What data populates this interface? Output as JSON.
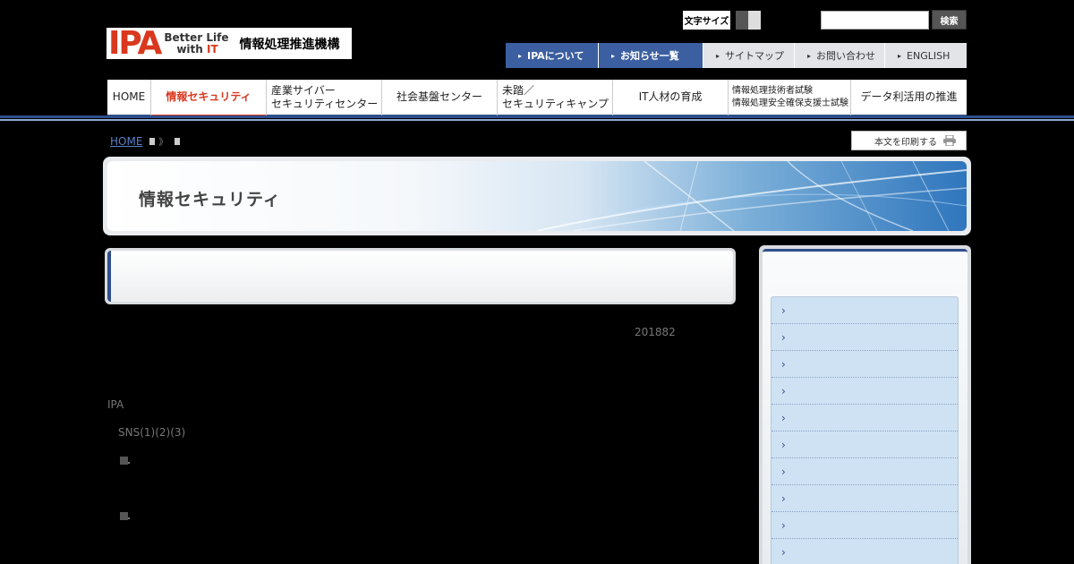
{
  "header": {
    "logo_mark": "IPA",
    "slogan_line1": "Better Life",
    "slogan_with": "with ",
    "slogan_it": "IT",
    "org_name": "情報処理推進機構",
    "font_size_label": "文字サイズ",
    "search_placeholder": "",
    "search_button": "検索"
  },
  "util_nav": [
    {
      "label": "IPAについて"
    },
    {
      "label": "お知らせ一覧"
    },
    {
      "label": "サイトマップ"
    },
    {
      "label": "お問い合わせ"
    },
    {
      "label": "ENGLISH"
    }
  ],
  "global_nav": [
    {
      "label": "HOME"
    },
    {
      "label": "情報セキュリティ"
    },
    {
      "line1": "産業サイバー",
      "line2": "セキュリティセンター"
    },
    {
      "label": "社会基盤センター"
    },
    {
      "line1": "未踏／",
      "line2": "セキュリティキャンプ"
    },
    {
      "label": "IT人材の育成"
    },
    {
      "line1": "情報処理技術者試験",
      "line2": "情報処理安全確保支援士試験"
    },
    {
      "label": "データ利活用の推進"
    }
  ],
  "breadcrumb": {
    "home": "HOME",
    "sep1": "》",
    "sep2": "》"
  },
  "print_button": "本文を印刷する",
  "banner_title": "情報セキュリティ",
  "content": {
    "date": "201882",
    "org": "IPA",
    "sns": "SNS(1)(2)(3)"
  },
  "sidebar": {
    "item_arrow": "›",
    "item_count": 10
  },
  "colors": {
    "accent_blue": "#2f4f8c",
    "accent_red": "#d9381e"
  }
}
